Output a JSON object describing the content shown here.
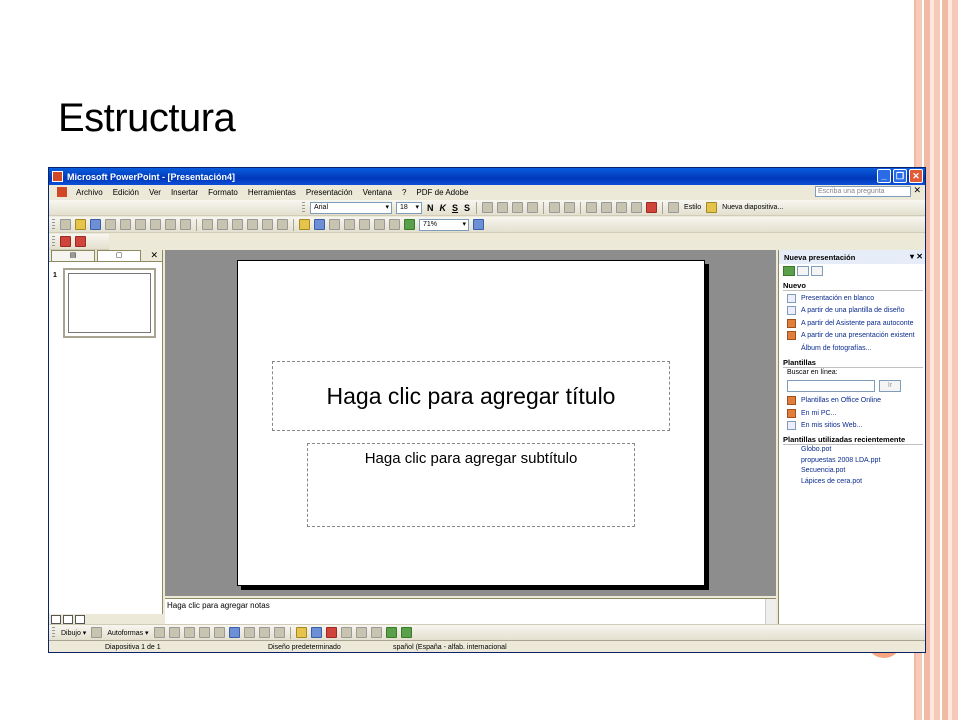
{
  "slide_heading": "Estructura",
  "app": {
    "title": "Microsoft PowerPoint - [Presentación4]",
    "window_buttons": [
      "_",
      "❐",
      "✕"
    ],
    "menu": [
      "Archivo",
      "Edición",
      "Ver",
      "Insertar",
      "Formato",
      "Herramientas",
      "Presentación",
      "Ventana",
      "?",
      "PDF de Adobe"
    ],
    "ask_placeholder": "Escriba una pregunta",
    "formatting": {
      "font": "Arial",
      "size": "18",
      "bold": "N",
      "italic": "K",
      "underline": "S",
      "shadow": "S",
      "design_label": "Estilo",
      "new_slide_label": "Nueva diapositiva..."
    },
    "standard": {
      "zoom": "71%"
    },
    "outline_tabs": [
      "▤",
      "▢"
    ],
    "slide_number": "1",
    "slide": {
      "title_placeholder": "Haga clic para agregar título",
      "subtitle_placeholder": "Haga clic para agregar subtítulo"
    },
    "notes_placeholder": "Haga clic para agregar notas",
    "task_pane": {
      "title": "Nueva presentación",
      "sections": {
        "new": "Nuevo",
        "templates": "Plantillas",
        "recent": "Plantillas utilizadas recientemente"
      },
      "new_links": [
        "Presentación en blanco",
        "A partir de una plantilla de diseño",
        "A partir del Asistente para autoconte",
        "A partir de una presentación existent",
        "Álbum de fotografías..."
      ],
      "search_label": "Buscar en línea:",
      "search_button": "Ir",
      "template_links": [
        "Plantillas en Office Online",
        "En mi PC...",
        "En mis sitios Web..."
      ],
      "recent_files": [
        "Globo.pot",
        "propuestas 2008 LDA.ppt",
        "Secuencia.pot",
        "Lápices de cera.pot"
      ]
    },
    "drawing": {
      "draw_label": "Dibujo ▾",
      "autoshapes_label": "Autoformas ▾"
    },
    "status": {
      "slide": "Diapositiva 1 de 1",
      "design": "Diseño predeterminado",
      "language": "spañol (España - alfab. internacional"
    }
  }
}
